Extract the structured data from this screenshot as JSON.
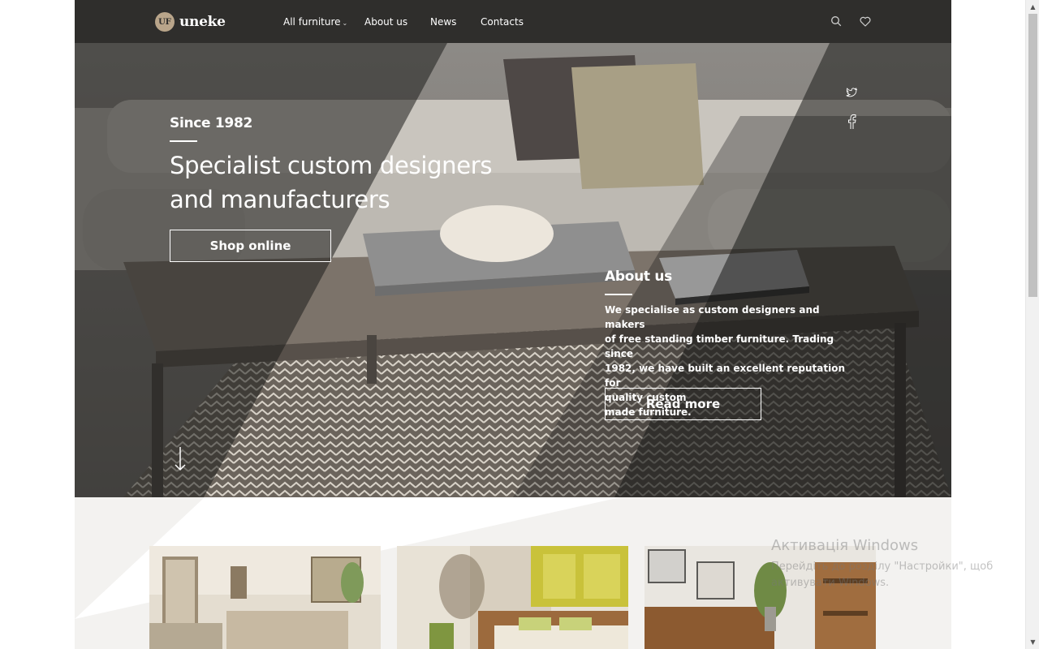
{
  "header": {
    "logo_badge": "UF",
    "logo_text": "uneke",
    "nav": [
      {
        "label": "All furniture",
        "has_dropdown": true
      },
      {
        "label": "About us"
      },
      {
        "label": "News"
      },
      {
        "label": "Contacts"
      }
    ],
    "icons": [
      "search-icon",
      "heart-icon"
    ]
  },
  "hero": {
    "since": "Since 1982",
    "headline": "Specialist custom designers and manufacturers",
    "shop_button": "Shop online",
    "about_title": "About us",
    "about_lines": [
      "We specialise as custom designers and makers",
      "of free standing timber furniture. Trading since",
      "1982, we have built an excellent reputation for",
      "quality custom",
      "made furniture."
    ],
    "read_more_button": "Read more",
    "social": [
      "twitter-icon",
      "facebook-icon"
    ]
  },
  "cards": [
    {
      "name": "living-room"
    },
    {
      "name": "bedroom"
    },
    {
      "name": "dining-room"
    }
  ],
  "watermark": {
    "title": "Активація Windows",
    "line1": "Перейдіть до розділу \"Настройки\", щоб",
    "line2": "активувати Windows."
  },
  "colors": {
    "header_bg": "#2f2e2c",
    "page_bg": "#f3f2f0",
    "text_light": "#ffffff"
  }
}
